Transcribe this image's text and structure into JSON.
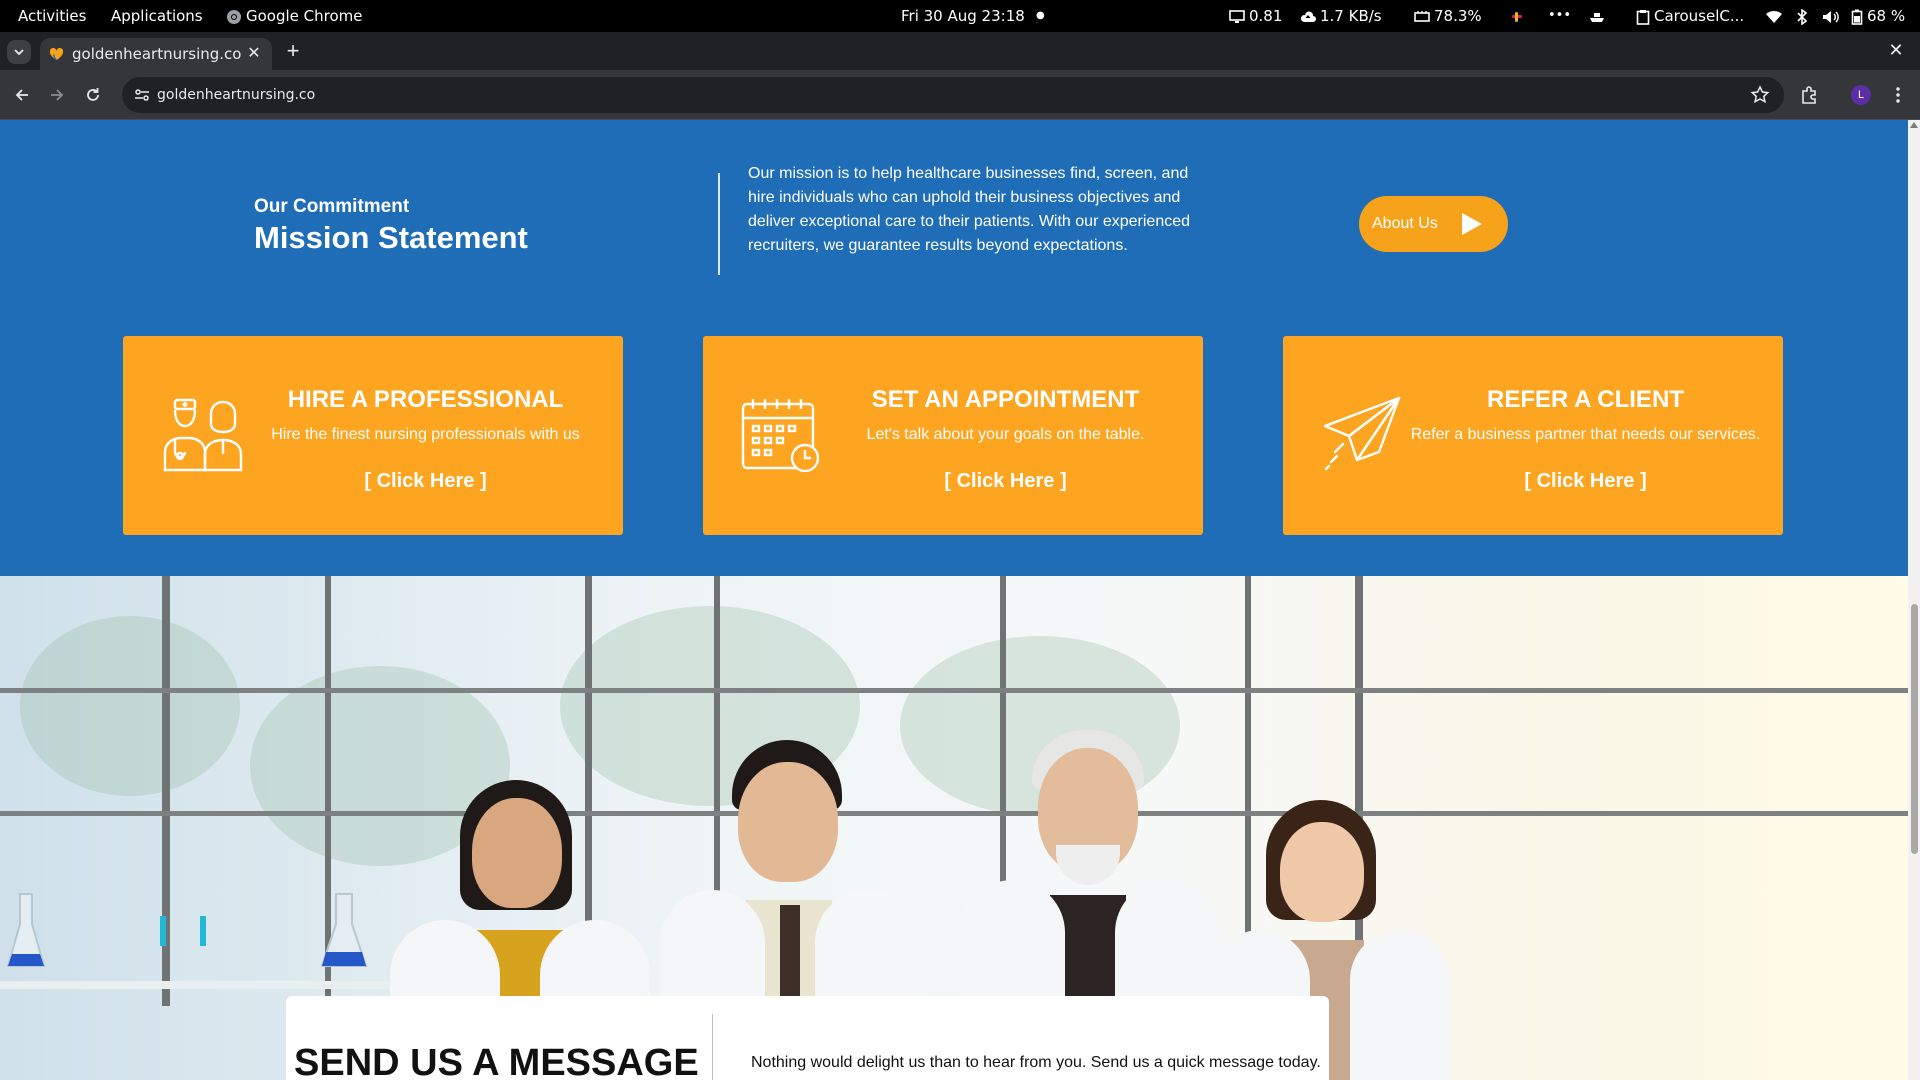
{
  "topbar": {
    "activities": "Activities",
    "applications": "Applications",
    "app_name": "Google Chrome",
    "datetime": "Fri 30 Aug  23:18",
    "load": "0.81",
    "net": "1.7 KB/s",
    "ram": "78.3%",
    "more": "•••",
    "clipboard": "CarouselC...",
    "battery": "68 %"
  },
  "browser": {
    "tab_title": "goldenheartnursing.co",
    "url": "goldenheartnursing.co",
    "profile_initial": "L"
  },
  "commitment": {
    "kicker": "Our Commitment",
    "title": "Mission Statement",
    "mission": "Our mission is to help healthcare businesses find, screen, and hire individuals who can uphold their business objectives and deliver exceptional care to their patients. With our experienced recruiters, we guarantee results beyond expectations.",
    "about_button": "About Us"
  },
  "cards": [
    {
      "icon": "nurses-icon",
      "title": "HIRE A PROFESSIONAL",
      "desc": "Hire the finest nursing professionals with us",
      "cta": "[ Click Here ]"
    },
    {
      "icon": "calendar-icon",
      "title": "SET AN APPOINTMENT",
      "desc": "Let's talk about your goals on the table.",
      "cta": "[ Click Here ]"
    },
    {
      "icon": "paper-plane-icon",
      "title": "REFER A CLIENT",
      "desc": "Refer a business partner that needs our services.",
      "cta": "[ Click Here ]"
    }
  ],
  "message": {
    "title": "SEND US A MESSAGE",
    "text": "Nothing would delight us than to hear from you. Send us a quick message today."
  },
  "colors": {
    "section_blue": "#1f6db6",
    "card_orange": "#fda420",
    "button_orange": "#f7a21b"
  }
}
